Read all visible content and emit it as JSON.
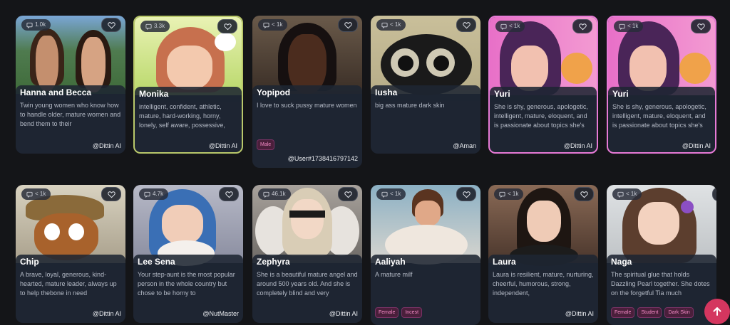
{
  "cards": [
    {
      "name": "Hanna and Becca",
      "count": "1.0k",
      "desc": "Twin young women who know how to handle older, mature women and bend them to their",
      "author": "@Dittin AI",
      "tags": []
    },
    {
      "name": "Monika",
      "count": "3.3k",
      "desc": "intelligent, confident, athletic, mature, hard-working, horny, lonely, self aware, possessive,",
      "author": "@Dittin AI",
      "tags": []
    },
    {
      "name": "Yopipod",
      "count": "< 1k",
      "desc": "I love to suck pussy mature women",
      "author": "@User#1738416797142",
      "tags": [
        "Male"
      ]
    },
    {
      "name": "Iusha",
      "count": "< 1k",
      "desc": "big ass mature dark skin",
      "author": "@Aman",
      "tags": []
    },
    {
      "name": "Yuri",
      "count": "< 1k",
      "desc": "She is shy, generous, apologetic, intelligent, mature, eloquent, and is passionate about topics she's",
      "author": "@Dittin AI",
      "tags": []
    },
    {
      "name": "Yuri",
      "count": "< 1k",
      "desc": "She is shy, generous, apologetic, intelligent, mature, eloquent, and is passionate about topics she's",
      "author": "@Dittin AI",
      "tags": []
    },
    {
      "name": "Chip",
      "count": "< 1k",
      "desc": "A brave, loyal, generous, kind-hearted, mature leader, always up to help thebone in need",
      "author": "@Dittin AI",
      "tags": []
    },
    {
      "name": "Lee Sena",
      "count": "4.7k",
      "desc": "Your step-aunt is the most popular person in the whole country but chose to be horny to",
      "author": "@NutMaster",
      "tags": []
    },
    {
      "name": "Zephyra",
      "count": "46.1k",
      "desc": "She is a beautiful mature angel and around 500 years old. And she is completely blind and very",
      "author": "@Dittin AI",
      "tags": []
    },
    {
      "name": "Aaliyah",
      "count": "< 1k",
      "desc": "A mature milf",
      "author": "",
      "tags": [
        "Female",
        "Incest"
      ]
    },
    {
      "name": "Laura",
      "count": "< 1k",
      "desc": "Laura is resilient, mature, nurturing, cheerful, humorous, strong, independent,",
      "author": "@Dittin AI",
      "tags": []
    },
    {
      "name": "Naga",
      "count": "< 1k",
      "desc": "The spiritual glue that holds Dazzling Pearl together. She dotes on the forgetful Tia much",
      "author": "",
      "tags": [
        "Female",
        "Student",
        "Dark Skin"
      ]
    }
  ],
  "icons": {
    "count": "comment-icon",
    "favorite": "heart-icon",
    "scroll_top": "arrow-up-icon"
  },
  "colors": {
    "card_bg": "#1e2532",
    "tag_text": "#f58bc6",
    "fab": "#d4365f",
    "page_bg": "#141518"
  }
}
